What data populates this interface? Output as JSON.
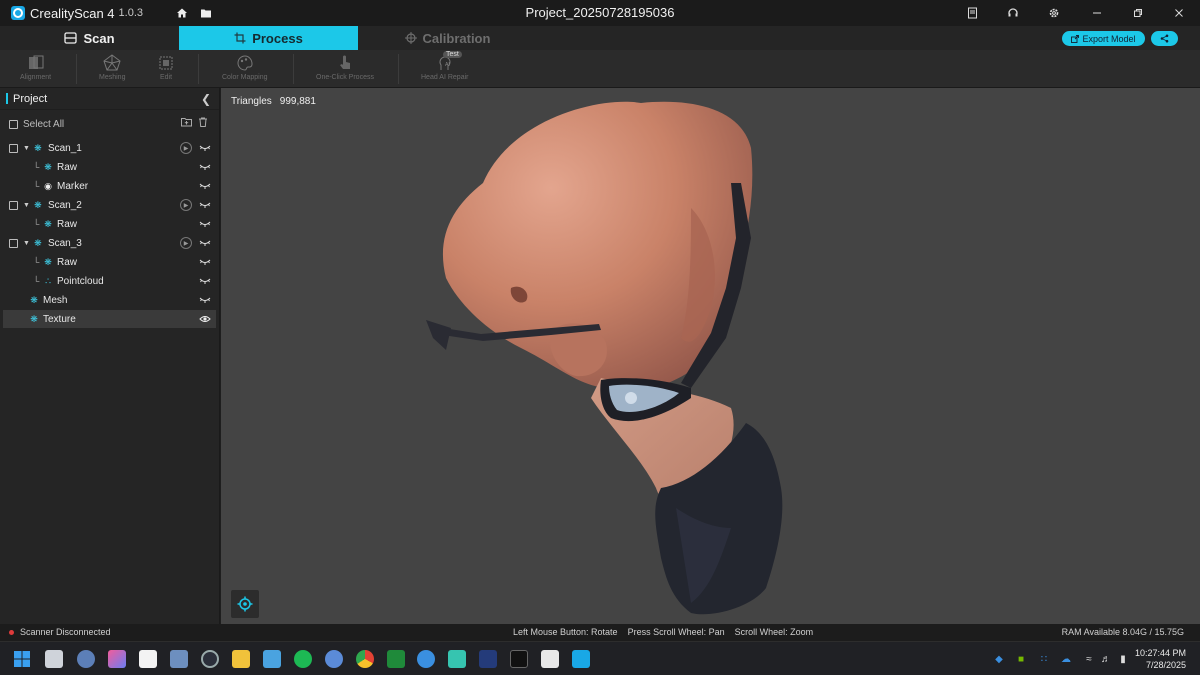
{
  "app": {
    "name": "CrealityScan 4",
    "version": "1.0.3",
    "project_title": "Project_20250728195036"
  },
  "modes": {
    "scan": "Scan",
    "process": "Process",
    "calibration": "Calibration",
    "active": "Process"
  },
  "header_buttons": {
    "export": "Export Model"
  },
  "toolbar": {
    "alignment": "Alignment",
    "meshing": "Meshing",
    "edit": "Edit",
    "color_mapping": "Color Mapping",
    "one_click": "One-Click Process",
    "head_ai": "Head AI Repair",
    "test_badge": "Test"
  },
  "sidebar": {
    "title": "Project",
    "select_all": "Select All",
    "items": [
      {
        "label": "Scan_1",
        "icon": "scan-icon"
      },
      {
        "label": "Raw",
        "icon": "raw-icon"
      },
      {
        "label": "Marker",
        "icon": "marker-icon"
      },
      {
        "label": "Scan_2",
        "icon": "scan-icon"
      },
      {
        "label": "Raw",
        "icon": "raw-icon"
      },
      {
        "label": "Scan_3",
        "icon": "scan-icon"
      },
      {
        "label": "Raw",
        "icon": "raw-icon"
      },
      {
        "label": "Pointcloud",
        "icon": "pointcloud-icon"
      },
      {
        "label": "Mesh",
        "icon": "mesh-icon"
      },
      {
        "label": "Texture",
        "icon": "texture-icon",
        "selected": true
      }
    ]
  },
  "viewport": {
    "triangles_label": "Triangles",
    "triangles_value": "999,881"
  },
  "status": {
    "scanner": "Scanner Disconnected",
    "hint_rotate": "Left Mouse Button: Rotate",
    "hint_pan": "Press Scroll Wheel: Pan",
    "hint_zoom": "Scroll Wheel: Zoom",
    "ram": "RAM Available 8.04G / 15.75G"
  },
  "taskbar": {
    "time": "10:27:44 PM",
    "date": "7/28/2025"
  },
  "colors": {
    "accent": "#1cc8e8",
    "viewport_bg": "#444444",
    "status_dot": "#e03b3b"
  }
}
